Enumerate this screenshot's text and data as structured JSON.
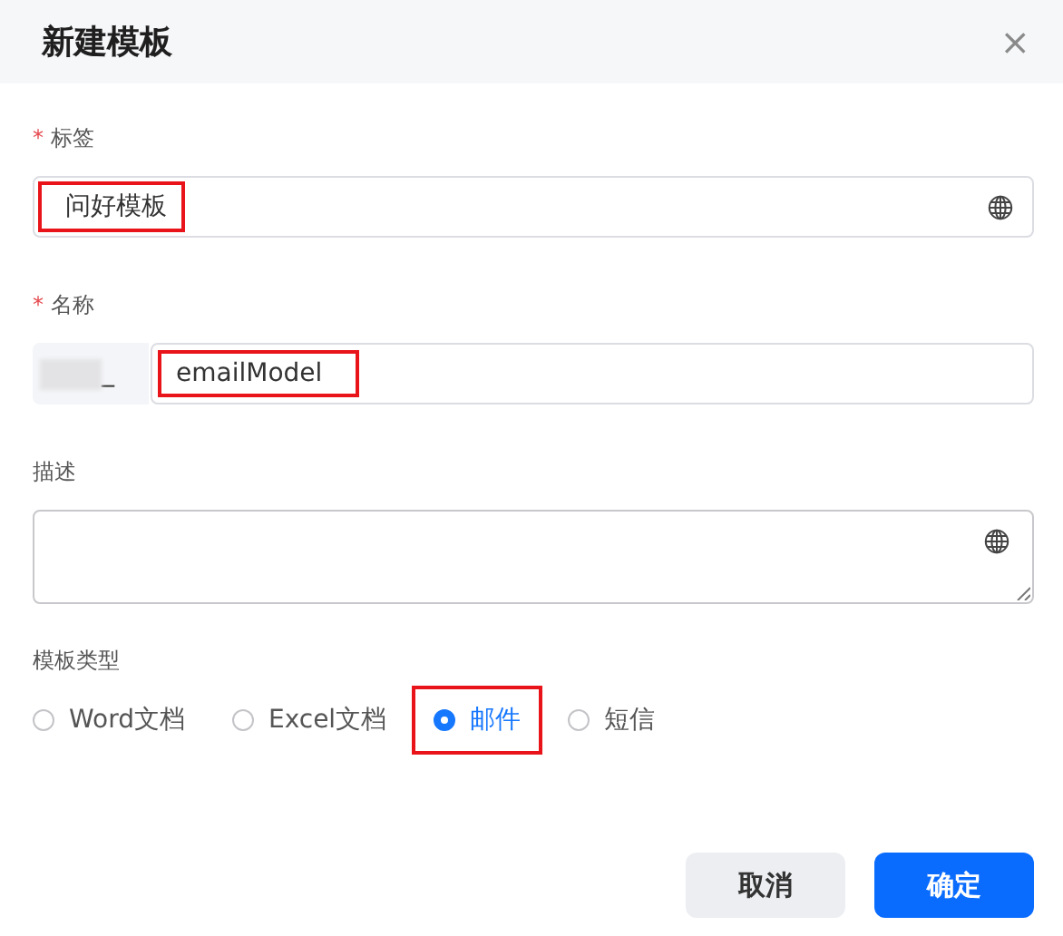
{
  "dialog": {
    "title": "新建模板",
    "close": "×"
  },
  "fields": [
    {
      "kind": "text",
      "label": "标签",
      "required_mark": "*",
      "value": "问好模板",
      "highlighted": true,
      "globe": true
    },
    {
      "kind": "prefixed",
      "label": "名称",
      "required_mark": "*",
      "prefix": "_",
      "value": "emailModel",
      "highlighted": true
    },
    {
      "kind": "textarea",
      "label": "描述",
      "globe": true
    }
  ],
  "template_type": {
    "label": "模板类型",
    "options": [
      {
        "label": "Word文档",
        "selected": false,
        "highlighted": false
      },
      {
        "label": "Excel文档",
        "selected": false,
        "highlighted": false
      },
      {
        "label": "邮件",
        "selected": true,
        "highlighted": true
      },
      {
        "label": "短信",
        "selected": false,
        "highlighted": false
      }
    ]
  },
  "buttons": [
    {
      "label": "取消",
      "kind": "secondary"
    },
    {
      "label": "确定",
      "kind": "primary"
    }
  ]
}
